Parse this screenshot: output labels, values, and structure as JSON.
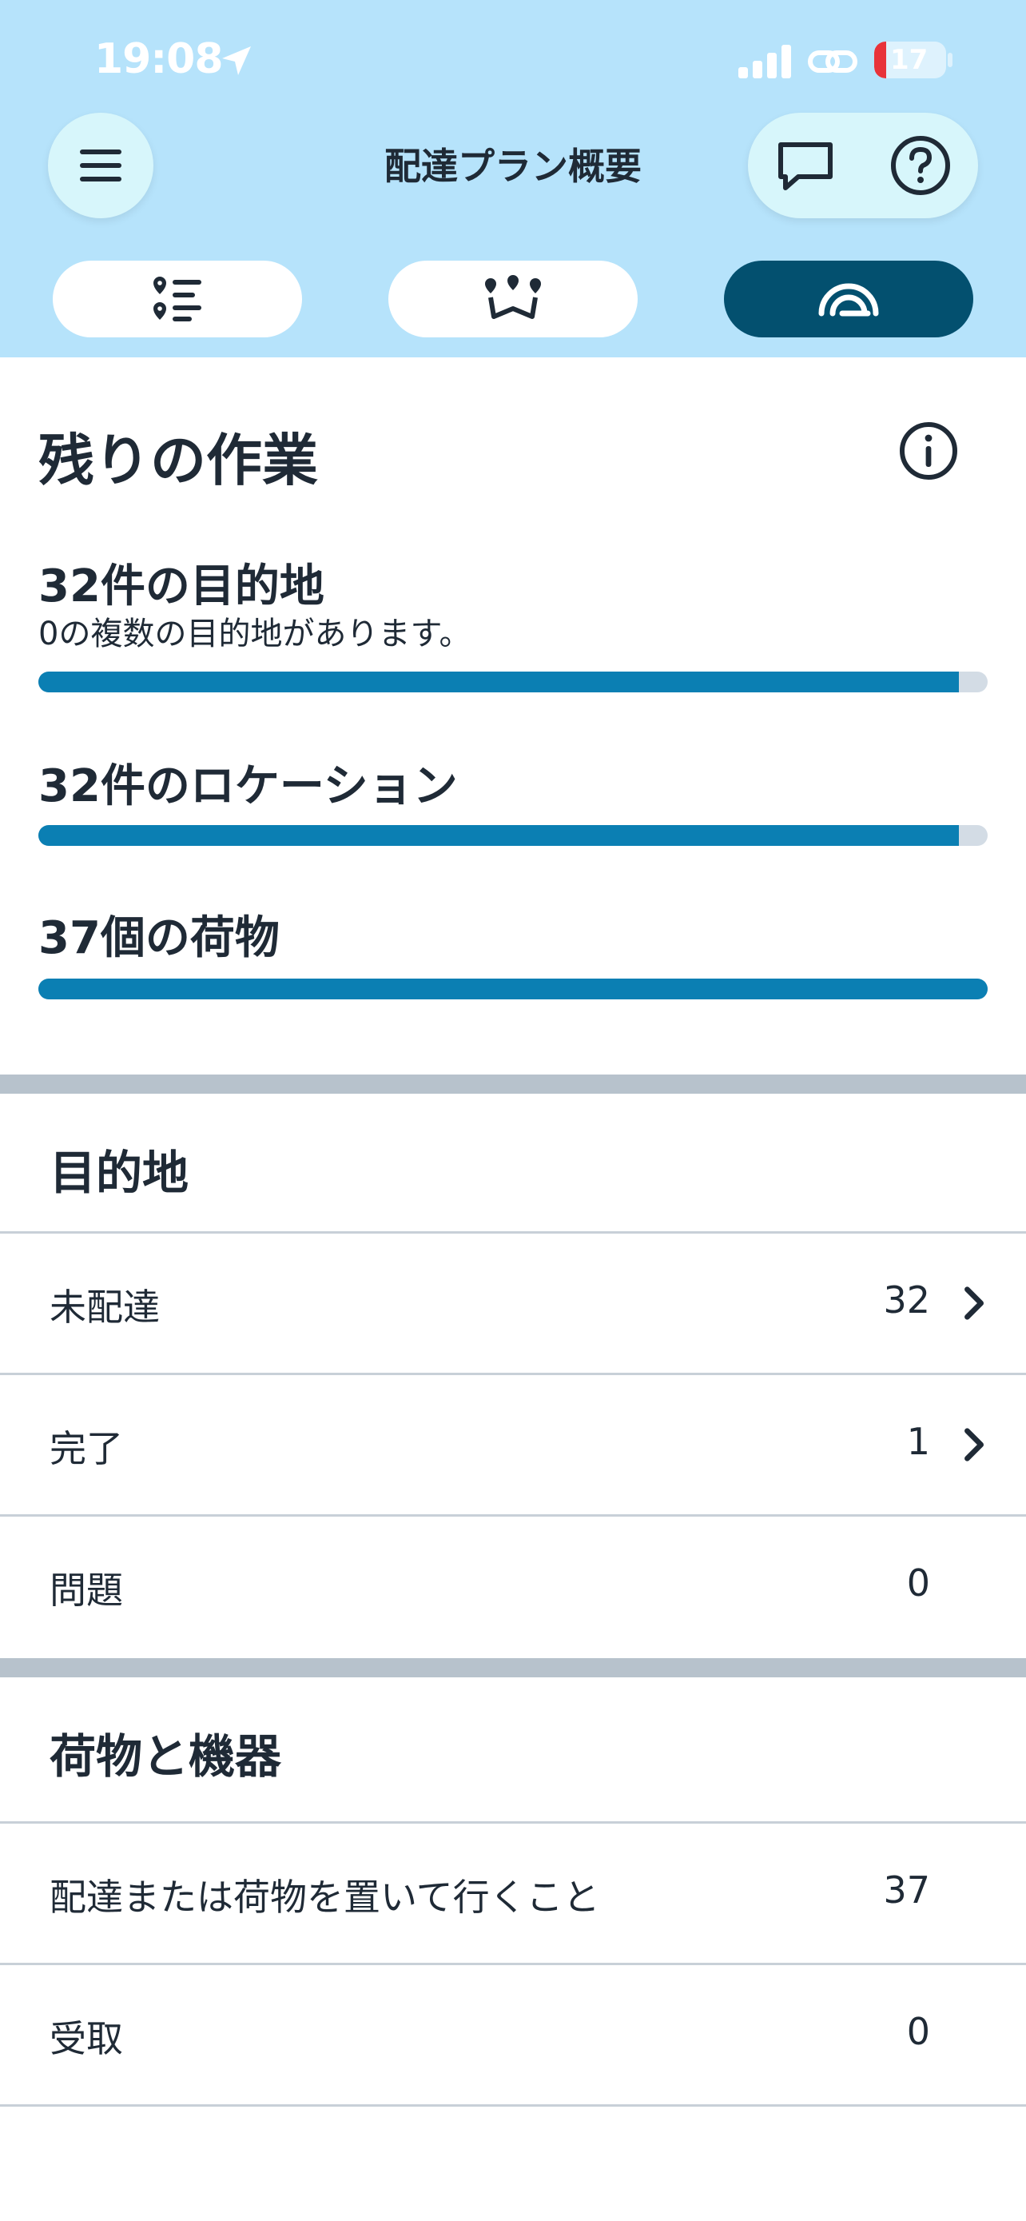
{
  "status_bar": {
    "time": "19:08",
    "battery_level": "17",
    "battery_fraction": 0.17,
    "icons": [
      "location-arrow-icon",
      "signal-icon",
      "link-icon",
      "battery-icon"
    ]
  },
  "header": {
    "title": "配達プラン概要",
    "buttons": [
      "menu-icon",
      "chat-icon",
      "help-icon"
    ]
  },
  "tabs": [
    {
      "icon": "list-pins-icon",
      "active": false
    },
    {
      "icon": "route-map-icon",
      "active": false
    },
    {
      "icon": "gauge-icon",
      "active": true
    }
  ],
  "remaining": {
    "title": "残りの作業",
    "metrics": [
      {
        "title": "32件の目的地",
        "subtitle": "0の複数の目的地があります。",
        "progress": 0.97
      },
      {
        "title": "32件のロケーション",
        "subtitle": "",
        "progress": 0.97
      },
      {
        "title": "37個の荷物",
        "subtitle": "",
        "progress": 1.0
      }
    ]
  },
  "destinations": {
    "title": "目的地",
    "rows": [
      {
        "label": "未配達",
        "count": "32",
        "chevron": true
      },
      {
        "label": "完了",
        "count": "1",
        "chevron": true
      },
      {
        "label": "問題",
        "count": "0",
        "chevron": false
      }
    ]
  },
  "packages": {
    "title": "荷物と機器",
    "rows": [
      {
        "label": "配達または荷物を置いて行くこと",
        "count": "37"
      },
      {
        "label": "受取",
        "count": "0"
      }
    ]
  },
  "colors": {
    "header_bg": "#b6e3fb",
    "accent": "#0b7fb3",
    "active_tab": "#03506f",
    "battery_red": "#e8333a"
  }
}
